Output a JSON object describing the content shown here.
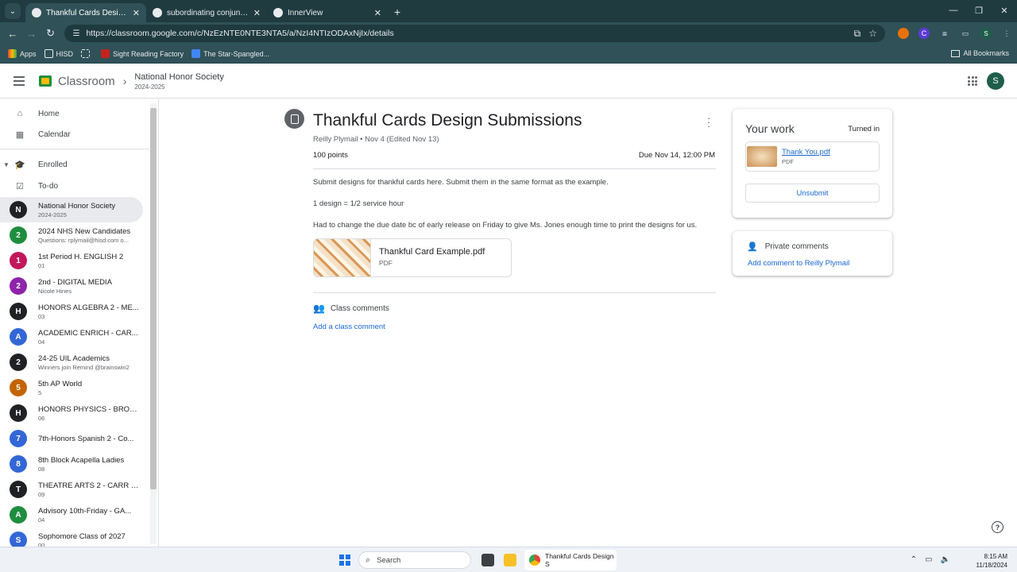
{
  "browser": {
    "tabs": [
      {
        "title": "Thankful Cards Design Submiss",
        "active": true
      },
      {
        "title": "subordinating conjunctions - G",
        "active": false
      },
      {
        "title": "InnerView",
        "active": false
      }
    ],
    "url": "https://classroom.google.com/c/NzEzNTE0NTE3NTA5/a/NzI4NTIzODAxNjIx/details",
    "bookmarks": [
      "Apps",
      "HISD",
      "Sight Reading Factory",
      "The Star-Spangled..."
    ],
    "all_bookmarks": "All Bookmarks"
  },
  "header": {
    "brand": "Classroom",
    "class_name": "National Honor Society",
    "class_year": "2024-2025",
    "avatar_letter": "S"
  },
  "sidebar": {
    "home": "Home",
    "calendar": "Calendar",
    "enrolled": "Enrolled",
    "todo": "To-do",
    "classes": [
      {
        "letter": "N",
        "color": "#202124",
        "name": "National Honor Society",
        "sub": "2024-2025",
        "selected": true
      },
      {
        "letter": "2",
        "color": "#1e8e3e",
        "name": "2024 NHS New Candidates",
        "sub": "Questions: rplymail@hisd.com o..."
      },
      {
        "letter": "1",
        "color": "#c2185b",
        "name": "1st Period H. ENGLISH 2",
        "sub": "01"
      },
      {
        "letter": "2",
        "color": "#8e24aa",
        "name": "2nd - DIGITAL MEDIA",
        "sub": "Nicole Hines"
      },
      {
        "letter": "H",
        "color": "#202124",
        "name": "HONORS ALGEBRA 2 - ME...",
        "sub": "03"
      },
      {
        "letter": "A",
        "color": "#3367d6",
        "name": "ACADEMIC ENRICH - CAR...",
        "sub": "04"
      },
      {
        "letter": "2",
        "color": "#202124",
        "name": "24-25 UIL Academics",
        "sub": "Winners join Remind @brainswin2"
      },
      {
        "letter": "5",
        "color": "#c26401",
        "name": "5th AP World",
        "sub": "5"
      },
      {
        "letter": "H",
        "color": "#202124",
        "name": "HONORS PHYSICS - BROW...",
        "sub": "06"
      },
      {
        "letter": "7",
        "color": "#3367d6",
        "name": "7th-Honors Spanish 2 - Co...",
        "sub": ""
      },
      {
        "letter": "8",
        "color": "#3367d6",
        "name": "8th Block Acapella Ladies",
        "sub": "08"
      },
      {
        "letter": "T",
        "color": "#202124",
        "name": "THEATRE ARTS 2 - CARR - ...",
        "sub": "09"
      },
      {
        "letter": "A",
        "color": "#1e8e3e",
        "name": "Advisory 10th-Friday - GA...",
        "sub": "04"
      },
      {
        "letter": "S",
        "color": "#3367d6",
        "name": "Sophomore Class of 2027",
        "sub": "00"
      }
    ]
  },
  "assignment": {
    "title": "Thankful Cards Design Submissions",
    "meta": "Reilly Plymail • Nov 4 (Edited Nov 13)",
    "points": "100 points",
    "due": "Due Nov 14, 12:00 PM",
    "paragraphs": [
      "Submit designs for thankful cards here. Submit them in the same format as the example.",
      "1 design = 1/2 service hour",
      "Had to change the due date bc of early release on Friday to give Ms. Jones enough time to print the designs for us."
    ],
    "attachment": {
      "name": "Thankful Card Example.pdf",
      "kind": "PDF"
    },
    "class_comments": "Class comments",
    "add_class_comment": "Add a class comment"
  },
  "your_work": {
    "title": "Your work",
    "status": "Turned in",
    "file_name": "Thank You.pdf",
    "file_kind": "PDF",
    "unsubmit": "Unsubmit"
  },
  "private_comments": {
    "title": "Private comments",
    "add": "Add comment to Reilly Plymail"
  },
  "taskbar": {
    "search": "Search",
    "chrome_label": "Thankful Cards Design S",
    "time": "8:15 AM",
    "date": "11/18/2024"
  }
}
